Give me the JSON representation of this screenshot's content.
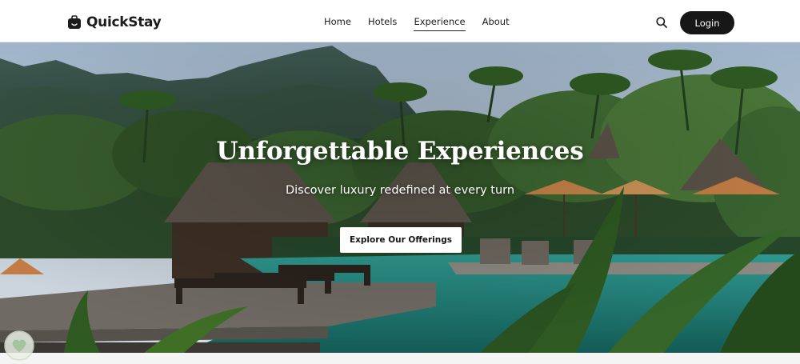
{
  "header": {
    "brand_name": "QuickStay",
    "nav": [
      {
        "label": "Home",
        "active": false
      },
      {
        "label": "Hotels",
        "active": false
      },
      {
        "label": "Experience",
        "active": true
      },
      {
        "label": "About",
        "active": false
      }
    ],
    "login_label": "Login"
  },
  "hero": {
    "title": "Unforgettable Experiences",
    "subtitle": "Discover luxury redefined at every turn",
    "cta_label": "Explore Our Offerings"
  },
  "colors": {
    "header_bg": "#ffffff",
    "login_bg": "#171717",
    "text_dark": "#1f1f1f",
    "pool": "#1f7f78"
  },
  "icons": {
    "brand": "suitcase-logo-icon",
    "search": "search-icon",
    "badge": "heart-shield-icon"
  }
}
